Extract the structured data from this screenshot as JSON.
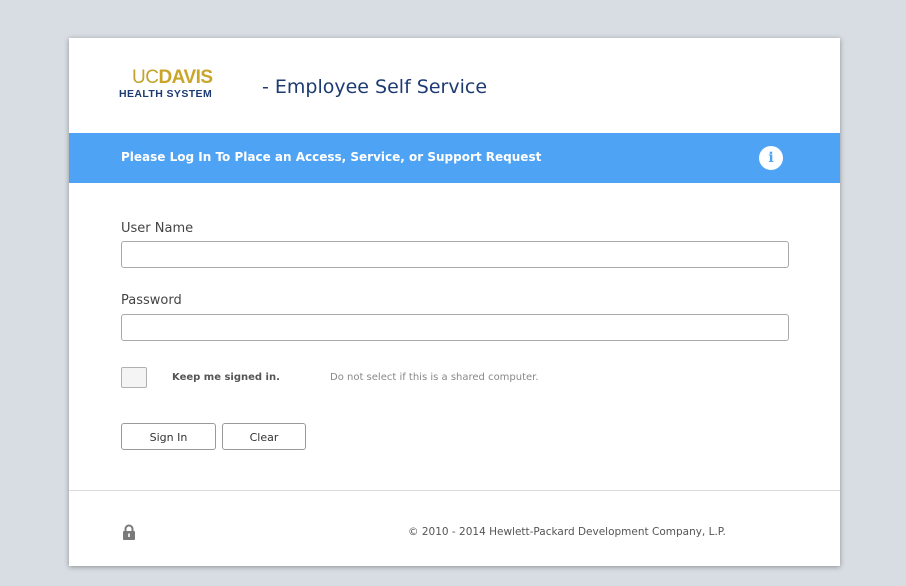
{
  "header": {
    "logo_uc": "UC",
    "logo_davis": "DAVIS",
    "logo_health_system": "HEALTH SYSTEM",
    "app_title": "- Employee Self Service"
  },
  "banner": {
    "message": "Please Log In To Place an Access, Service, or Support Request",
    "info_icon": "i",
    "color": "#4fa3f4"
  },
  "form": {
    "username_label": "User Name",
    "username_value": "",
    "password_label": "Password",
    "password_value": "",
    "keep_signed_in_label": "Keep me signed in.",
    "keep_signed_in_checked": false,
    "shared_computer_note": "Do not select if this is a shared computer.",
    "sign_in_label": "Sign In",
    "clear_label": "Clear"
  },
  "footer": {
    "lock_icon": "lock-icon",
    "copyright": "© 2010 - 2014 Hewlett-Packard Development Company, L.P."
  },
  "colors": {
    "background": "#d8dde3",
    "brand_navy": "#1d3b72",
    "brand_gold": "#c9a52a"
  }
}
